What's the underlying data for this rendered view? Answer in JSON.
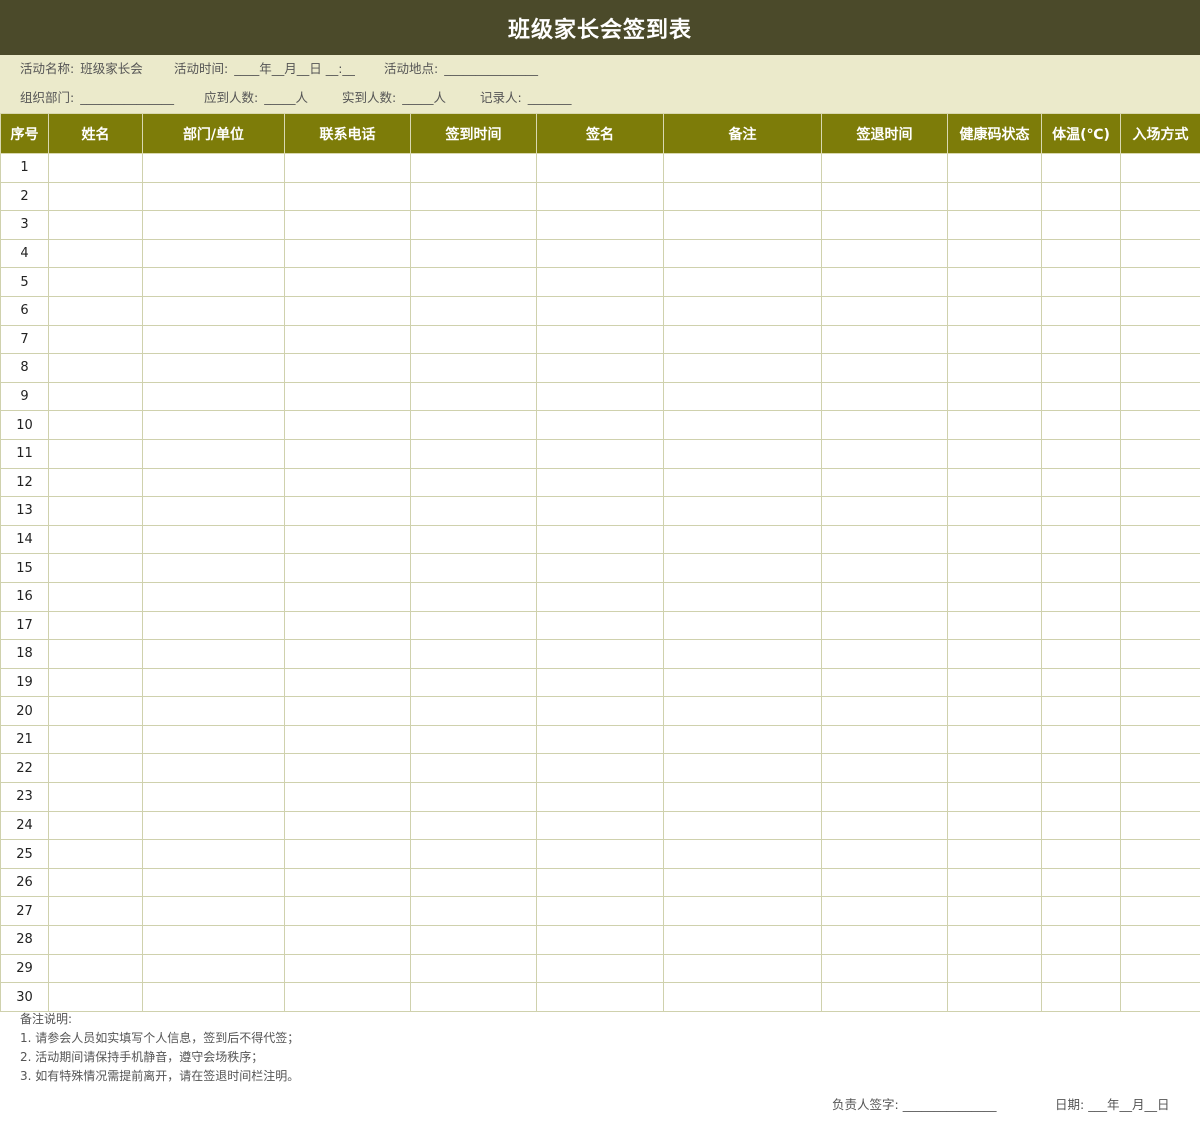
{
  "title": "班级家长会签到表",
  "info": {
    "activity_name_label": "活动名称:",
    "activity_name_value": "班级家长会",
    "activity_time_label": "活动时间:",
    "activity_time_value": "____年__月__日  __:__",
    "activity_place_label": "活动地点:",
    "activity_place_value": "_______________",
    "organizer_label": "组织部门:",
    "organizer_value": "_______________",
    "expected_label": "应到人数:",
    "expected_value": "_____人",
    "actual_label": "实到人数:",
    "actual_value": "_____人",
    "recorder_label": "记录人:",
    "recorder_value": "_______"
  },
  "table": {
    "headers": [
      "序号",
      "姓名",
      "部门/单位",
      "联系电话",
      "签到时间",
      "签名",
      "备注",
      "签退时间",
      "健康码状态",
      "体温(℃)",
      "入场方式"
    ],
    "row_numbers": [
      "1",
      "2",
      "3",
      "4",
      "5",
      "6",
      "7",
      "8",
      "9",
      "10",
      "11",
      "12",
      "13",
      "14",
      "15",
      "16",
      "17",
      "18",
      "19",
      "20",
      "21",
      "22",
      "23",
      "24",
      "25",
      "26",
      "27",
      "28",
      "29",
      "30"
    ]
  },
  "notes": {
    "heading": "备注说明:",
    "items": [
      "1. 请参会人员如实填写个人信息，签到后不得代签；",
      "2. 活动期间请保持手机静音，遵守会场秩序；",
      "3. 如有特殊情况需提前离开，请在签退时间栏注明。"
    ]
  },
  "footer": {
    "signature_label": "负责人签字:",
    "signature_value": "_______________",
    "date_label": "日期:",
    "date_value": "___年__月__日"
  },
  "colors": {
    "title_bg": "#4b4a2a",
    "info_bg": "#ebeacb",
    "header_bg": "#7d7c09",
    "border": "#cfd1ad"
  }
}
